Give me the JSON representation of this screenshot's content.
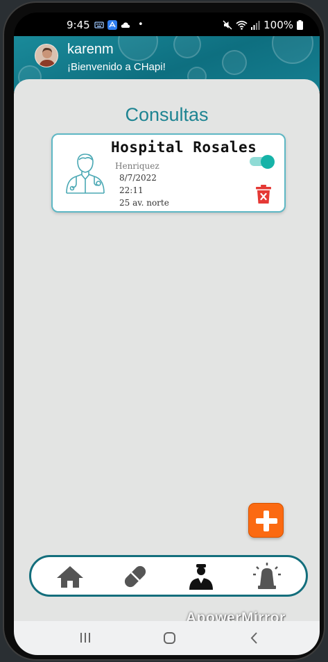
{
  "status_bar": {
    "time": "9:45",
    "battery": "100%",
    "dot": "•"
  },
  "header": {
    "username": "karenm",
    "welcome": "¡Bienvenido a CHapi!"
  },
  "main": {
    "title": "Consultas",
    "appointments": [
      {
        "hospital": "Hospital Rosales",
        "doctor": "Henriquez",
        "date": "8/7/2022",
        "time": "22:11",
        "address": "25 av. norte",
        "reminder_enabled": true
      }
    ]
  },
  "bottom_nav": {
    "items": [
      "home-icon",
      "pill-icon",
      "doctor-icon",
      "alarm-light-icon"
    ],
    "active": "doctor-icon"
  },
  "watermark": "ApowerMirror",
  "colors": {
    "header": "#0e6f80",
    "accent": "#1e8492",
    "fab": "#fb6a12",
    "delete": "#e53935",
    "toggle": "#16b3a8"
  }
}
